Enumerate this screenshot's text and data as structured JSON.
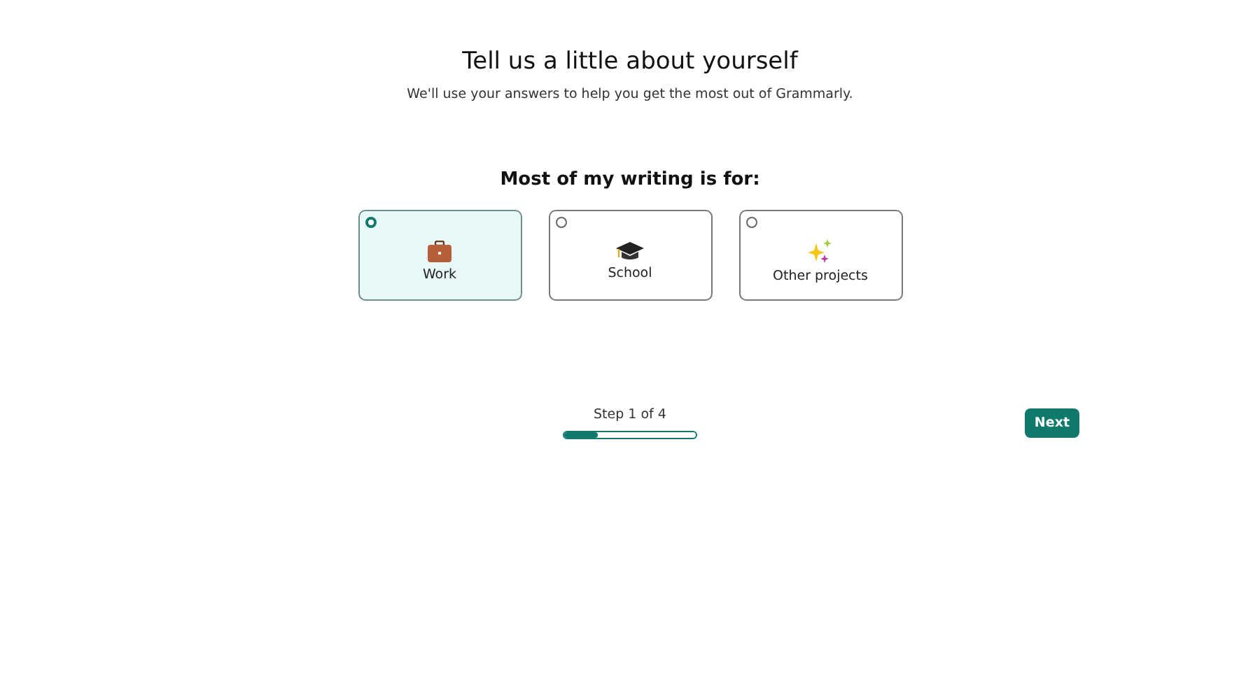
{
  "header": {
    "title": "Tell us a little about yourself",
    "subtitle": "We'll use your answers to help you get the most out of Grammarly."
  },
  "question": "Most of my writing is for:",
  "options": [
    {
      "label": "Work",
      "kind": "briefcase",
      "selected": true
    },
    {
      "label": "School",
      "kind": "cap",
      "selected": false
    },
    {
      "label": "Other projects",
      "kind": "sparkles",
      "selected": false
    }
  ],
  "progress": {
    "label": "Step 1 of 4",
    "level": 0.25
  },
  "next_button": "Next"
}
